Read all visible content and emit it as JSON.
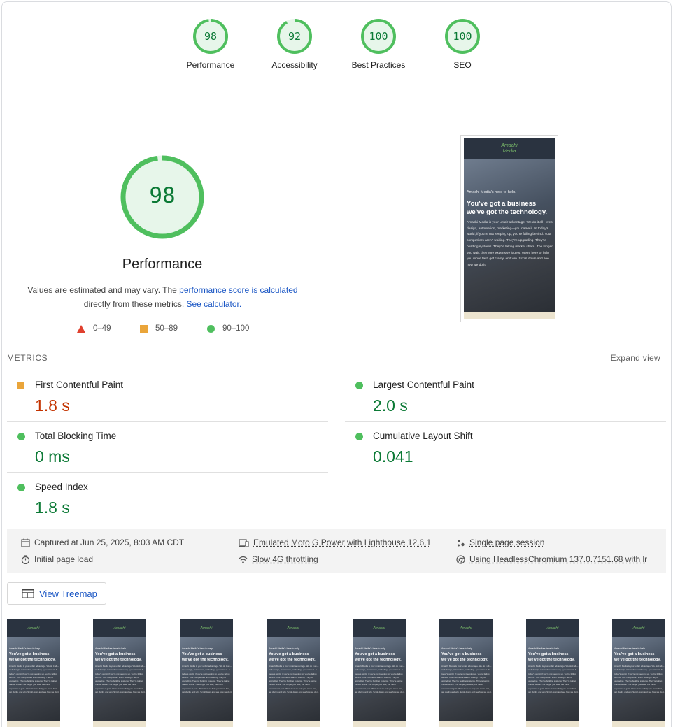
{
  "categories": [
    {
      "label": "Performance",
      "score": "98"
    },
    {
      "label": "Accessibility",
      "score": "92"
    },
    {
      "label": "Best Practices",
      "score": "100"
    },
    {
      "label": "SEO",
      "score": "100"
    }
  ],
  "main_gauge": {
    "score": "98",
    "title": "Performance"
  },
  "note": {
    "text1": "Values are estimated and may vary. The ",
    "link1": "performance score is calculated",
    "text2": "directly from these metrics. ",
    "link2": "See calculator."
  },
  "legend": {
    "poor": "0–49",
    "average": "50–89",
    "good": "90–100"
  },
  "colors": {
    "good": "#0c7a36",
    "average": "#c33300",
    "good_marker": "#4fbf5e",
    "average_marker": "#eaa53a",
    "poor_marker": "#e0402e",
    "link": "#1a56c4"
  },
  "screenshot": {
    "logo_line1": "Amachi",
    "logo_line2": "Media",
    "kicker": "Amachi Media's here to help.",
    "headline": "You've got a business we've got the technology.",
    "body": "Amachi Media is your unfair advantage. We do it all—web design, automation, marketing—you name it. In today's world, if you're not keeping up, you're falling behind. Your competitors aren't waiting. They're upgrading. They're building systems. They're taking market share. The longer you wait, the more expensive it gets. We're here to help you move fast, get clarity, and win. Scroll down and see how we do it."
  },
  "metrics": {
    "header": "METRICS",
    "expand": "Expand view",
    "fcp": {
      "label": "First Contentful Paint",
      "value": "1.8 s"
    },
    "lcp": {
      "label": "Largest Contentful Paint",
      "value": "2.0 s"
    },
    "tbt": {
      "label": "Total Blocking Time",
      "value": "0 ms"
    },
    "cls": {
      "label": "Cumulative Layout Shift",
      "value": "0.041"
    },
    "si": {
      "label": "Speed Index",
      "value": "1.8 s"
    }
  },
  "env": {
    "captured": "Captured at Jun 25, 2025, 8:03 AM CDT",
    "load": "Initial page load",
    "device": "Emulated Moto G Power with Lighthouse 12.6.1",
    "throttle": "Slow 4G throttling",
    "session": "Single page session",
    "browser": "Using HeadlessChromium 137.0.7151.68 with lr"
  },
  "treemap_label": "View Treemap",
  "filmstrip_frames": 8
}
